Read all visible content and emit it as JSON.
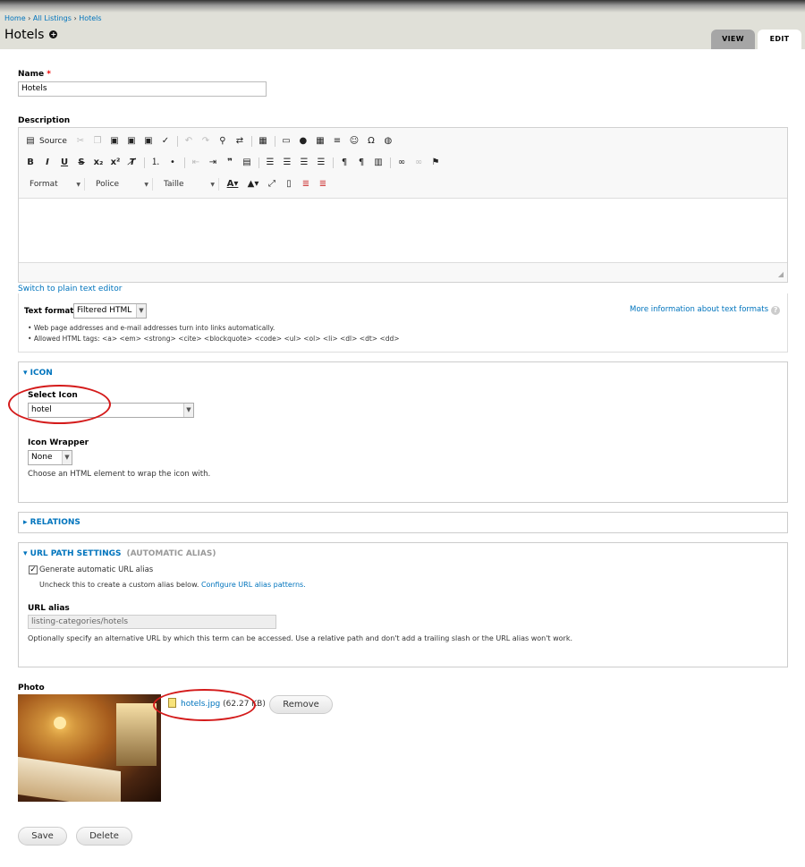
{
  "breadcrumb": [
    "Home",
    "All Listings",
    "Hotels"
  ],
  "page_title": "Hotels",
  "tabs": {
    "view": "VIEW",
    "edit": "EDIT"
  },
  "name": {
    "label": "Name",
    "required_mark": "*",
    "value": "Hotels"
  },
  "description": {
    "label": "Description",
    "toolbar": {
      "source_label": "Source",
      "format_label": "Format",
      "font_label": "Police",
      "size_label": "Taille"
    },
    "switch_link": "Switch to plain text editor"
  },
  "text_format": {
    "label": "Text format",
    "value": "Filtered HTML",
    "more_info": "More information about text formats",
    "tips": [
      "Web page addresses and e-mail addresses turn into links automatically.",
      "Allowed HTML tags: <a> <em> <strong> <cite> <blockquote> <code> <ul> <ol> <li> <dl> <dt> <dd>"
    ]
  },
  "icon_fieldset": {
    "legend": "ICON",
    "select_label": "Select Icon",
    "select_value": "hotel",
    "wrapper_label": "Icon Wrapper",
    "wrapper_value": "None",
    "wrapper_desc": "Choose an HTML element to wrap the icon with."
  },
  "relations": {
    "legend": "RELATIONS"
  },
  "url_settings": {
    "legend": "URL PATH SETTINGS",
    "legend_summary": "(AUTOMATIC ALIAS)",
    "checkbox_label": "Generate automatic URL alias",
    "checkbox_checked": true,
    "uncheck_text": "Uncheck this to create a custom alias below.",
    "configure_link": "Configure URL alias patterns.",
    "alias_label": "URL alias",
    "alias_value": "listing-categories/hotels",
    "alias_desc": "Optionally specify an alternative URL by which this term can be accessed. Use a relative path and don't add a trailing slash or the URL alias won't work."
  },
  "photo": {
    "label": "Photo",
    "file_name": "hotels.jpg",
    "file_size": "(62.27 KB)",
    "remove_label": "Remove"
  },
  "actions": {
    "save": "Save",
    "delete": "Delete"
  },
  "colors": {
    "link": "#0074bd",
    "annotation": "#d41b1b"
  }
}
